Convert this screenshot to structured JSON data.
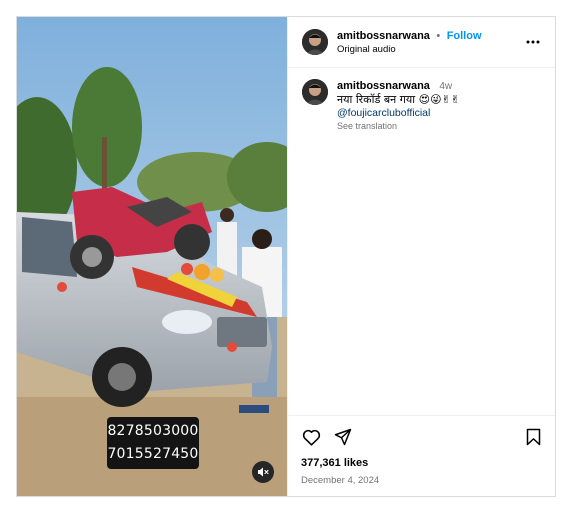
{
  "post": {
    "header": {
      "username": "amitbossnarwana",
      "separator": "•",
      "follow_label": "Follow",
      "audio_label": "Original audio",
      "more_icon": "more-horizontal-icon"
    },
    "caption": {
      "username": "amitbossnarwana",
      "time_ago": "4w",
      "text": "नया रिकॉर्ड बन गया 😍😜✌✌",
      "mention": "@foujicarclubofficial",
      "translate_label": "See translation"
    },
    "media": {
      "phone_numbers": [
        "8278503000",
        "7015527450"
      ],
      "mute_icon": "speaker-muted-icon"
    },
    "actions": {
      "like_icon": "heart-icon",
      "share_icon": "share-icon",
      "save_icon": "bookmark-icon",
      "likes_text": "377,361 likes",
      "date_text": "December 4, 2024"
    }
  }
}
